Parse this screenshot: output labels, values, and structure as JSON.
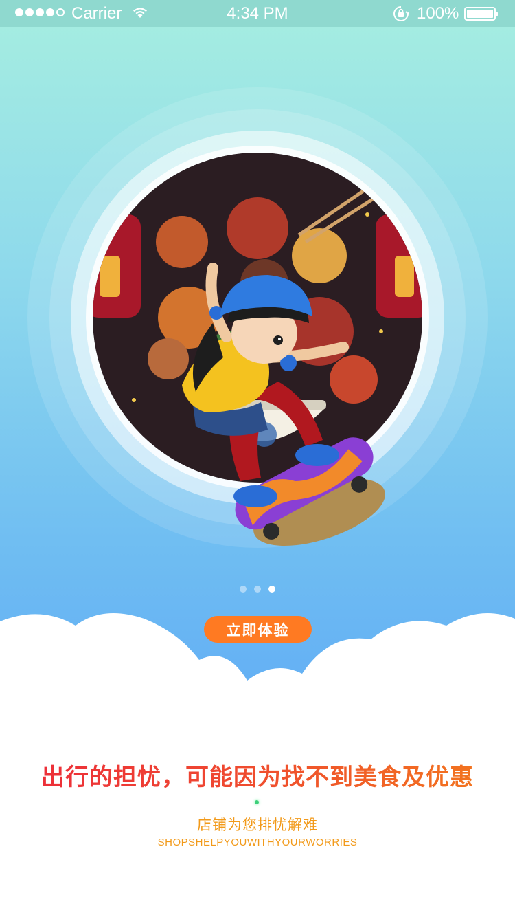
{
  "status_bar": {
    "carrier": "Carrier",
    "time": "4:34 PM",
    "battery": "100%",
    "signal_icon": "signal-dots-icon",
    "wifi_icon": "wifi-icon",
    "lock_icon": "rotation-lock-icon",
    "battery_icon": "battery-icon"
  },
  "hero": {
    "image": "girl-skateboard-food-illustration"
  },
  "pager": {
    "total": 3,
    "active_index": 2
  },
  "cta": {
    "label": "立即体验",
    "color": "#ff7a22"
  },
  "content": {
    "headline": "出行的担忧，可能因为找不到美食及优惠",
    "subtitle": "店铺为您排忧解难",
    "subtitle_en": "SHOPSHELPYOUWITHYOURWORRIES"
  },
  "colors": {
    "headline_start": "#ec2a3b",
    "headline_end": "#f37a1c",
    "subtitle": "#f29a1a"
  }
}
